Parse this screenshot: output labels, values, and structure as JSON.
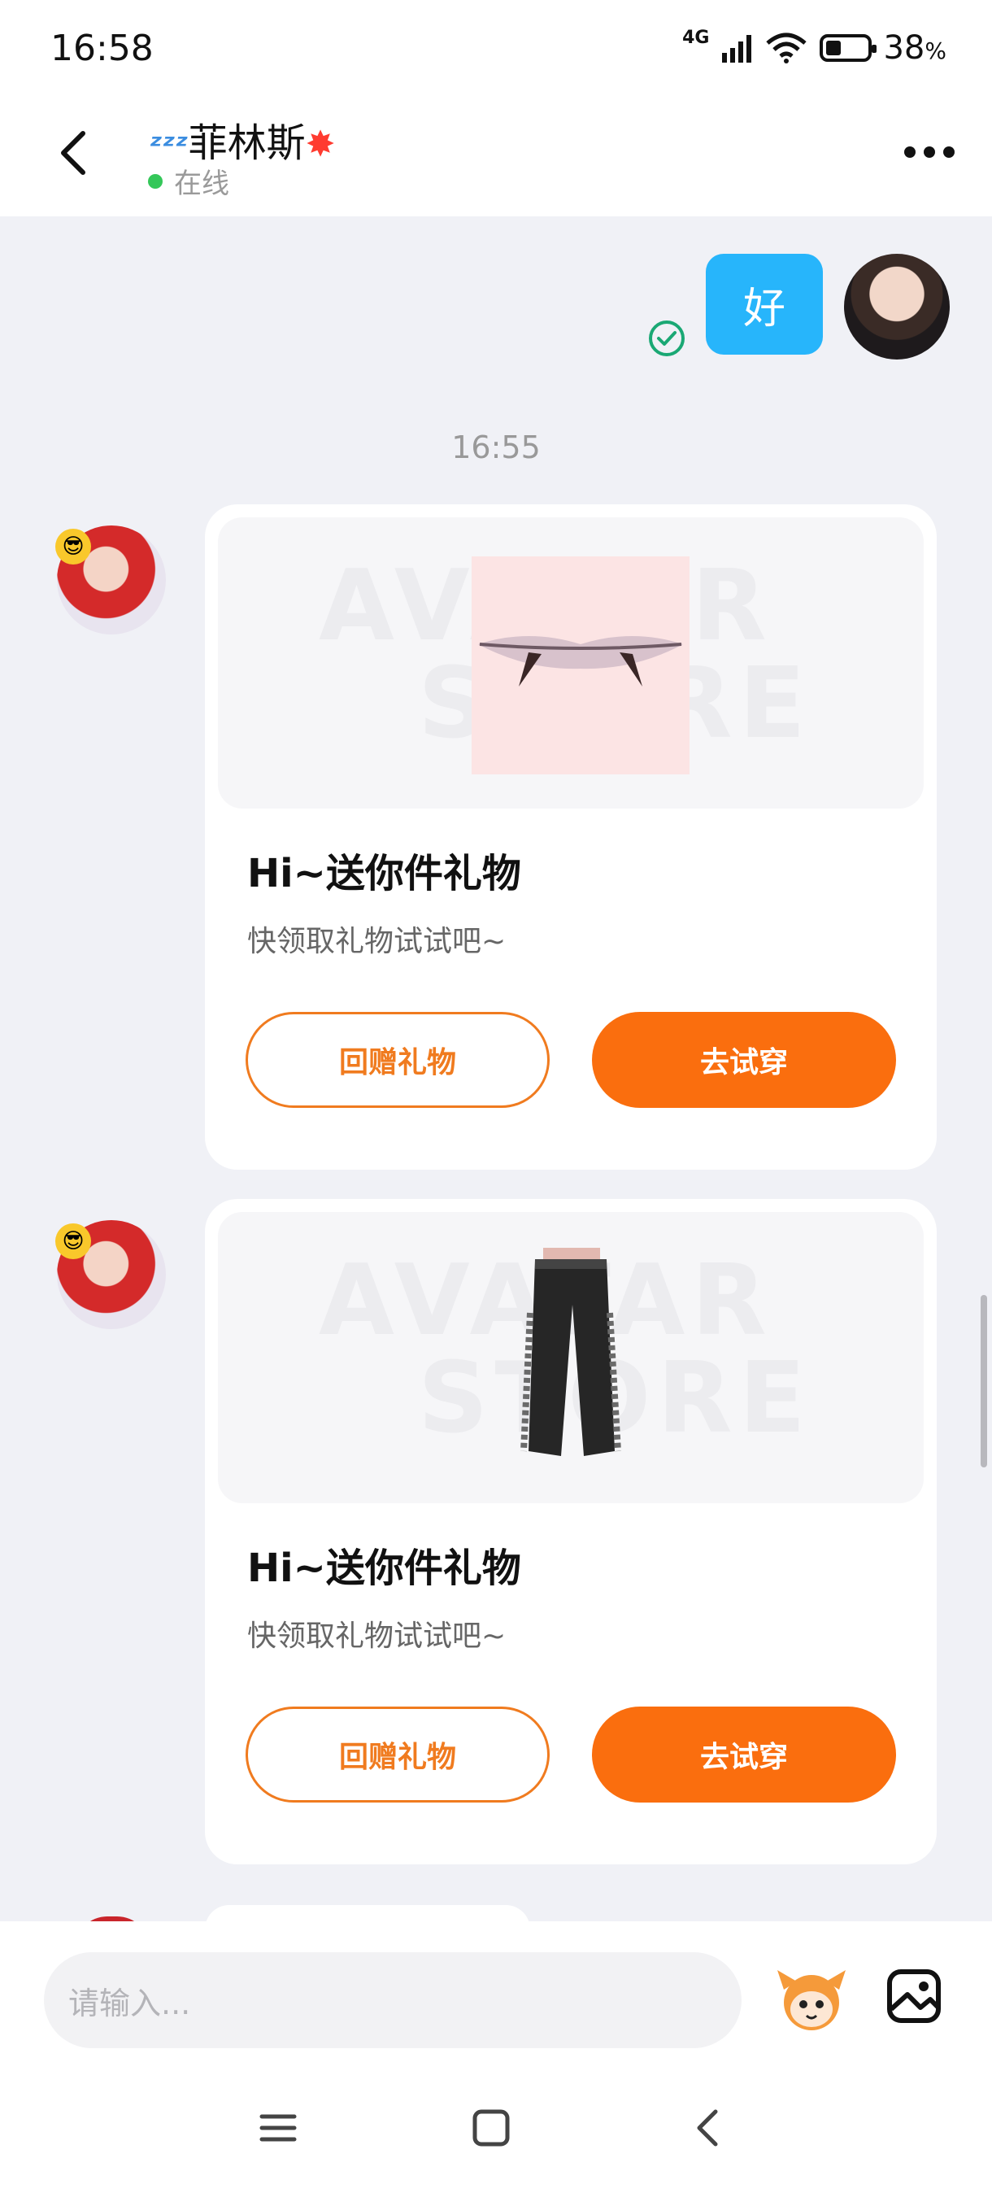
{
  "status_bar": {
    "time": "16:58",
    "network": "4G",
    "battery": "38",
    "battery_unit": "%",
    "battery_level": 0.38
  },
  "header": {
    "contact_name": "菲林斯",
    "status": "在线"
  },
  "chat": {
    "my_message": "好",
    "timestamp": "16:55",
    "gift_cards": [
      {
        "item": "vampire-fangs",
        "title": "Hi~送你件礼物",
        "desc": "快领取礼物试试吧~",
        "return_label": "回赠礼物",
        "try_label": "去试穿"
      },
      {
        "item": "leather-pants",
        "title": "Hi~送你件礼物",
        "desc": "快领取礼物试试吧~",
        "return_label": "回赠礼物",
        "try_label": "去试穿"
      }
    ],
    "watermark_line1": "AVATAR",
    "watermark_line2": "STORE"
  },
  "input": {
    "placeholder": "请输入..."
  },
  "colors": {
    "accent_orange": "#fa6e0e",
    "bubble_blue": "#27b5fb",
    "online_green": "#34c759"
  },
  "icons": [
    "back-arrow-icon",
    "more-icon",
    "check-circle-icon",
    "mascot-icon",
    "image-icon",
    "menu-icon",
    "home-icon",
    "nav-back-icon"
  ]
}
